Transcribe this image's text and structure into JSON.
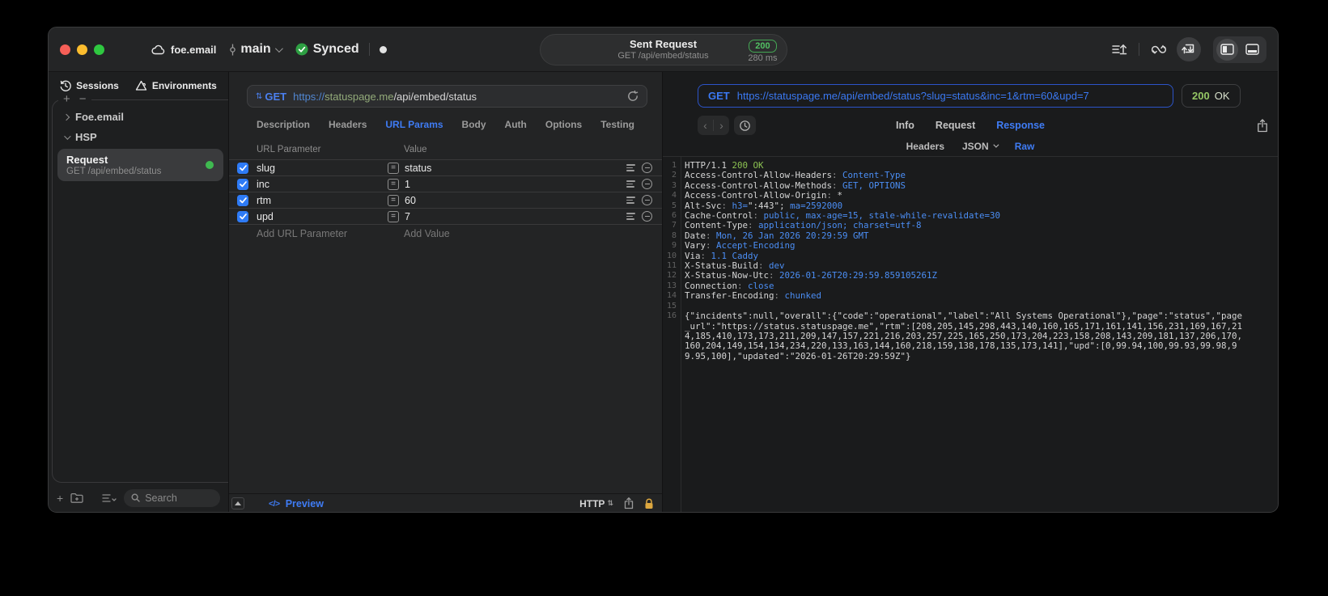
{
  "titlebar": {
    "project": "foe.email",
    "branch": "main",
    "sync_label": "Synced",
    "center": {
      "title": "Sent Request",
      "subtitle": "GET /api/embed/status",
      "status_code": "200",
      "duration": "280 ms"
    }
  },
  "sidebar": {
    "tabs": [
      {
        "label": "Sessions"
      },
      {
        "label": "Environments"
      }
    ],
    "tree": [
      {
        "label": "Foe.email"
      },
      {
        "label": "HSP"
      }
    ],
    "request_item": {
      "title": "Request",
      "subtitle": "GET /api/embed/status"
    },
    "search_placeholder": "Search"
  },
  "request_panel": {
    "method": "GET",
    "url_scheme": "https://",
    "url_host": "statuspage.me",
    "url_path": "/api/embed/status",
    "tabs": [
      "Description",
      "Headers",
      "URL Params",
      "Body",
      "Auth",
      "Options",
      "Testing"
    ],
    "active_tab": "URL Params",
    "table": {
      "col_param": "URL Parameter",
      "col_value": "Value",
      "rows": [
        {
          "name": "slug",
          "value": "status",
          "enabled": true
        },
        {
          "name": "inc",
          "value": "1",
          "enabled": true
        },
        {
          "name": "rtm",
          "value": "60",
          "enabled": true
        },
        {
          "name": "upd",
          "value": "7",
          "enabled": true
        }
      ],
      "add_param_placeholder": "Add URL Parameter",
      "add_value_placeholder": "Add Value"
    },
    "bottom": {
      "preview_label": "Preview",
      "protocol": "HTTP"
    }
  },
  "response_panel": {
    "request_line": {
      "method": "GET",
      "url": "https://statuspage.me/api/embed/status?slug=status&inc=1&rtm=60&upd=7"
    },
    "status": {
      "code": "200",
      "text": "OK"
    },
    "tabs": [
      "Info",
      "Request",
      "Response"
    ],
    "active_tab": "Response",
    "subtabs": [
      "Headers",
      "JSON",
      "Raw"
    ],
    "active_subtab": "Raw",
    "code_lines": [
      {
        "n": "1",
        "seg": [
          [
            "HTTP/1.1 ",
            "p"
          ],
          [
            "200 OK",
            "g"
          ]
        ]
      },
      {
        "n": "2",
        "seg": [
          [
            "Access-Control-Allow-Headers",
            "p"
          ],
          [
            ": ",
            "d"
          ],
          [
            "Content-Type",
            "b"
          ]
        ]
      },
      {
        "n": "3",
        "seg": [
          [
            "Access-Control-Allow-Methods",
            "p"
          ],
          [
            ": ",
            "d"
          ],
          [
            "GET, OPTIONS",
            "b"
          ]
        ]
      },
      {
        "n": "4",
        "seg": [
          [
            "Access-Control-Allow-Origin",
            "p"
          ],
          [
            ": ",
            "d"
          ],
          [
            "*",
            "p"
          ]
        ]
      },
      {
        "n": "5",
        "seg": [
          [
            "Alt-Svc",
            "p"
          ],
          [
            ": ",
            "d"
          ],
          [
            "h3=",
            "b"
          ],
          [
            "\":443\"",
            "p"
          ],
          [
            "; ",
            "p"
          ],
          [
            "ma=2592000",
            "b"
          ]
        ]
      },
      {
        "n": "6",
        "seg": [
          [
            "Cache-Control",
            "p"
          ],
          [
            ": ",
            "d"
          ],
          [
            "public, max-age=15, stale-while-revalidate=30",
            "b"
          ]
        ]
      },
      {
        "n": "7",
        "seg": [
          [
            "Content-Type",
            "p"
          ],
          [
            ": ",
            "d"
          ],
          [
            "application/json; charset=utf-8",
            "b"
          ]
        ]
      },
      {
        "n": "8",
        "seg": [
          [
            "Date",
            "p"
          ],
          [
            ": ",
            "d"
          ],
          [
            "Mon, 26 Jan 2026 20:29:59 GMT",
            "b"
          ]
        ]
      },
      {
        "n": "9",
        "seg": [
          [
            "Vary",
            "p"
          ],
          [
            ": ",
            "d"
          ],
          [
            "Accept-Encoding",
            "b"
          ]
        ]
      },
      {
        "n": "10",
        "seg": [
          [
            "Via",
            "p"
          ],
          [
            ": ",
            "d"
          ],
          [
            "1.1 Caddy",
            "b"
          ]
        ]
      },
      {
        "n": "11",
        "seg": [
          [
            "X-Status-Build",
            "p"
          ],
          [
            ": ",
            "d"
          ],
          [
            "dev",
            "b"
          ]
        ]
      },
      {
        "n": "12",
        "seg": [
          [
            "X-Status-Now-Utc",
            "p"
          ],
          [
            ": ",
            "d"
          ],
          [
            "2026-01-26T20:29:59.859105261Z",
            "b"
          ]
        ]
      },
      {
        "n": "13",
        "seg": [
          [
            "Connection",
            "p"
          ],
          [
            ": ",
            "d"
          ],
          [
            "close",
            "b"
          ]
        ]
      },
      {
        "n": "14",
        "seg": [
          [
            "Transfer-Encoding",
            "p"
          ],
          [
            ": ",
            "d"
          ],
          [
            "chunked",
            "b"
          ]
        ]
      },
      {
        "n": "15",
        "seg": []
      },
      {
        "n": "16",
        "seg": [
          [
            "{\"incidents\":null,\"overall\":{\"code\":\"operational\",\"label\":\"All Systems Operational\"},\"page\":\"status\",\"page_url\":\"https://status.statuspage.me\",\"rtm\":[208,205,145,298,443,140,160,165,171,161,141,156,231,169,167,214,185,410,173,173,211,209,147,157,221,216,203,257,225,165,250,173,204,223,158,208,143,209,181,137,206,170,160,204,149,154,134,234,220,133,163,144,160,218,159,138,178,135,173,141],\"upd\":[0,99.94,100,99.93,99.98,99.95,100],\"updated\":\"2026-01-26T20:29:59Z\"}",
            "p"
          ]
        ]
      }
    ]
  },
  "glyphs": {
    "plus": "+",
    "minus": "−",
    "updown": "⇅",
    "eq": "=",
    "code": "</>",
    "nav_back": "‹",
    "nav_forward": "›"
  },
  "colors": {
    "accent_blue": "#3f7cf5",
    "success_green": "#3fb950",
    "badge_green": "#52c163",
    "code_value_blue": "#4b8ef5",
    "code_status_green": "#8cc252",
    "url_host_green": "#93ab7a",
    "lock_yellow": "#dca73f"
  }
}
